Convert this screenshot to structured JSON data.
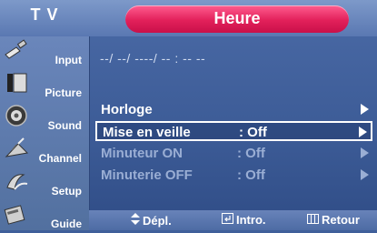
{
  "header": {
    "source_label": "T V",
    "title": "Heure"
  },
  "sidebar": {
    "items": [
      {
        "label": "Input",
        "icon": "input-plug-icon"
      },
      {
        "label": "Picture",
        "icon": "picture-icon"
      },
      {
        "label": "Sound",
        "icon": "speaker-icon"
      },
      {
        "label": "Channel",
        "icon": "antenna-icon"
      },
      {
        "label": "Setup",
        "icon": "setup-icon"
      },
      {
        "label": "Guide",
        "icon": "guide-icon"
      }
    ]
  },
  "main": {
    "datetime": "--/ --/ ----/ -- : -- --",
    "rows": [
      {
        "label": "Horloge",
        "value": "",
        "state": "enabled"
      },
      {
        "label": "Mise en veille",
        "value": ": Off",
        "state": "selected"
      },
      {
        "label": "Minuteur ON",
        "value": ": Off",
        "state": "disabled"
      },
      {
        "label": "Minuterie OFF",
        "value": ": Off",
        "state": "disabled"
      }
    ]
  },
  "footer": {
    "move_label": "Dépl.",
    "enter_label": "Intro.",
    "return_label": "Retour"
  },
  "colors": {
    "background": "#3f5f9a",
    "header_pill": "#e2205a",
    "disabled_text": "#9aaed4"
  }
}
